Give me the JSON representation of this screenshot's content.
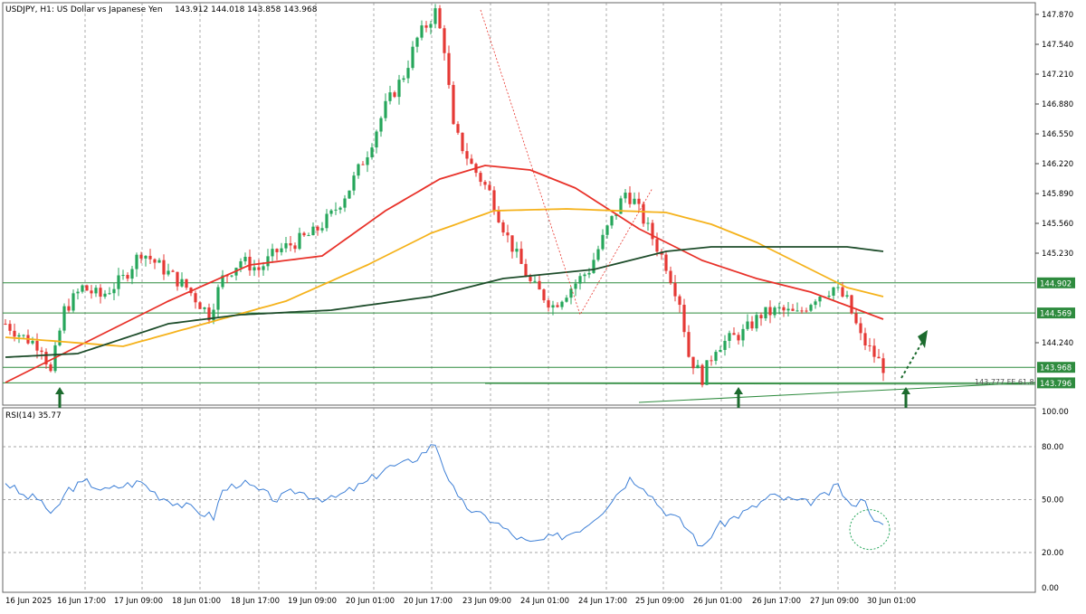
{
  "header": {
    "symbol_info": "USDJPY, H1:  US Dollar vs Japanese Yen",
    "ohlc": "143.912 144.018 143.858 143.968"
  },
  "rsi_label": "RSI(14) 35.77",
  "fe_label": "143.777 FE 61.8",
  "colors": {
    "bull": "#26a65b",
    "bear": "#e53935",
    "ma_red": "#e8322a",
    "ma_orange": "#f5b21b",
    "ma_dark": "#1e4d2b",
    "hline": "#2e8b3e",
    "rsi": "#3d7fd6",
    "grid": "#888888"
  },
  "chart_data": [
    {
      "type": "candlestick",
      "title": "USDJPY, H1:  US Dollar vs Japanese Yen",
      "ylim": [
        143.55,
        148.0
      ],
      "y_ticks": [
        "147.870",
        "147.540",
        "147.210",
        "146.880",
        "146.550",
        "146.220",
        "145.890",
        "145.560",
        "145.230",
        "144.240"
      ],
      "x_ticks": [
        "16 Jun 2025",
        "16 Jun 17:00",
        "17 Jun 09:00",
        "18 Jun 01:00",
        "18 Jun 17:00",
        "19 Jun 09:00",
        "20 Jun 01:00",
        "20 Jun 17:00",
        "23 Jun 09:00",
        "24 Jun 01:00",
        "24 Jun 17:00",
        "25 Jun 09:00",
        "26 Jun 01:00",
        "26 Jun 17:00",
        "27 Jun 09:00",
        "30 Jun 01:00"
      ],
      "close_path": [
        [
          0,
          144.45
        ],
        [
          4,
          144.3
        ],
        [
          8,
          144.2
        ],
        [
          10,
          143.9
        ],
        [
          13,
          144.6
        ],
        [
          17,
          144.85
        ],
        [
          21,
          144.75
        ],
        [
          26,
          144.95
        ],
        [
          30,
          145.25
        ],
        [
          35,
          145.05
        ],
        [
          40,
          144.85
        ],
        [
          45,
          144.55
        ],
        [
          48,
          144.95
        ],
        [
          52,
          145.15
        ],
        [
          56,
          145.05
        ],
        [
          60,
          145.25
        ],
        [
          64,
          145.35
        ],
        [
          68,
          145.45
        ],
        [
          72,
          145.65
        ],
        [
          76,
          145.95
        ],
        [
          80,
          146.35
        ],
        [
          84,
          146.85
        ],
        [
          88,
          147.2
        ],
        [
          91,
          147.6
        ],
        [
          95,
          147.9
        ],
        [
          97,
          147.5
        ],
        [
          99,
          146.6
        ],
        [
          103,
          146.2
        ],
        [
          107,
          145.9
        ],
        [
          111,
          145.4
        ],
        [
          116,
          144.9
        ],
        [
          121,
          144.65
        ],
        [
          125,
          144.85
        ],
        [
          129,
          145.05
        ],
        [
          133,
          145.5
        ],
        [
          137,
          145.9
        ],
        [
          139,
          145.8
        ],
        [
          142,
          145.5
        ],
        [
          146,
          145.1
        ],
        [
          149,
          144.7
        ],
        [
          151,
          144.1
        ],
        [
          154,
          143.85
        ],
        [
          157,
          144.2
        ],
        [
          161,
          144.3
        ],
        [
          163,
          144.35
        ],
        [
          167,
          144.55
        ],
        [
          171,
          144.6
        ],
        [
          175,
          144.55
        ],
        [
          179,
          144.75
        ],
        [
          183,
          144.85
        ],
        [
          186,
          144.7
        ],
        [
          189,
          144.3
        ],
        [
          192,
          144.1
        ],
        [
          194,
          143.97
        ]
      ],
      "moving_averages": [
        {
          "color": "red",
          "points": [
            [
              0,
              143.8
            ],
            [
              20,
              144.3
            ],
            [
              36,
              144.7
            ],
            [
              54,
              145.1
            ],
            [
              70,
              145.2
            ],
            [
              84,
              145.7
            ],
            [
              96,
              146.05
            ],
            [
              106,
              146.2
            ],
            [
              116,
              146.15
            ],
            [
              126,
              145.95
            ],
            [
              140,
              145.5
            ],
            [
              154,
              145.15
            ],
            [
              166,
              144.95
            ],
            [
              178,
              144.8
            ],
            [
              194,
              144.5
            ]
          ]
        },
        {
          "color": "orange",
          "points": [
            [
              0,
              144.3
            ],
            [
              26,
              144.2
            ],
            [
              44,
              144.45
            ],
            [
              62,
              144.7
            ],
            [
              80,
              145.1
            ],
            [
              94,
              145.45
            ],
            [
              108,
              145.7
            ],
            [
              124,
              145.72
            ],
            [
              146,
              145.68
            ],
            [
              156,
              145.55
            ],
            [
              166,
              145.35
            ],
            [
              176,
              145.1
            ],
            [
              186,
              144.85
            ],
            [
              194,
              144.75
            ]
          ]
        },
        {
          "color": "dark-green",
          "points": [
            [
              0,
              144.08
            ],
            [
              16,
              144.12
            ],
            [
              36,
              144.45
            ],
            [
              52,
              144.55
            ],
            [
              72,
              144.6
            ],
            [
              94,
              144.75
            ],
            [
              110,
              144.95
            ],
            [
              130,
              145.05
            ],
            [
              146,
              145.25
            ],
            [
              156,
              145.3
            ],
            [
              172,
              145.3
            ],
            [
              186,
              145.3
            ],
            [
              194,
              145.25
            ]
          ]
        }
      ],
      "horizontal_levels": [
        "144.902",
        "144.569",
        "143.968",
        "143.796"
      ],
      "annotations": [
        "143.777 FE 61.8"
      ]
    },
    {
      "type": "line",
      "title": "RSI(14) 35.77",
      "ylim": [
        0,
        100
      ],
      "y_ticks": [
        "100.00",
        "80.00",
        "50.00",
        "20.00",
        "0.00"
      ],
      "series": [
        {
          "name": "RSI(14)",
          "points": [
            [
              0,
              60
            ],
            [
              4,
              52
            ],
            [
              8,
              50
            ],
            [
              10,
              40
            ],
            [
              14,
              56
            ],
            [
              18,
              60
            ],
            [
              22,
              55
            ],
            [
              26,
              58
            ],
            [
              30,
              60
            ],
            [
              34,
              52
            ],
            [
              38,
              48
            ],
            [
              42,
              44
            ],
            [
              46,
              40
            ],
            [
              48,
              55
            ],
            [
              52,
              60
            ],
            [
              56,
              55
            ],
            [
              60,
              50
            ],
            [
              64,
              55
            ],
            [
              68,
              52
            ],
            [
              72,
              50
            ],
            [
              76,
              55
            ],
            [
              80,
              60
            ],
            [
              84,
              68
            ],
            [
              88,
              70
            ],
            [
              91,
              74
            ],
            [
              95,
              82
            ],
            [
              97,
              68
            ],
            [
              100,
              50
            ],
            [
              104,
              42
            ],
            [
              108,
              38
            ],
            [
              112,
              30
            ],
            [
              116,
              25
            ],
            [
              120,
              28
            ],
            [
              124,
              30
            ],
            [
              128,
              35
            ],
            [
              132,
              44
            ],
            [
              136,
              56
            ],
            [
              138,
              62
            ],
            [
              141,
              58
            ],
            [
              145,
              45
            ],
            [
              149,
              38
            ],
            [
              152,
              30
            ],
            [
              154,
              22
            ],
            [
              157,
              34
            ],
            [
              161,
              40
            ],
            [
              165,
              45
            ],
            [
              169,
              52
            ],
            [
              173,
              50
            ],
            [
              177,
              48
            ],
            [
              181,
              52
            ],
            [
              184,
              58
            ],
            [
              187,
              45
            ],
            [
              189,
              52
            ],
            [
              191,
              44
            ],
            [
              193,
              36
            ],
            [
              194,
              35.77
            ]
          ]
        }
      ]
    }
  ]
}
